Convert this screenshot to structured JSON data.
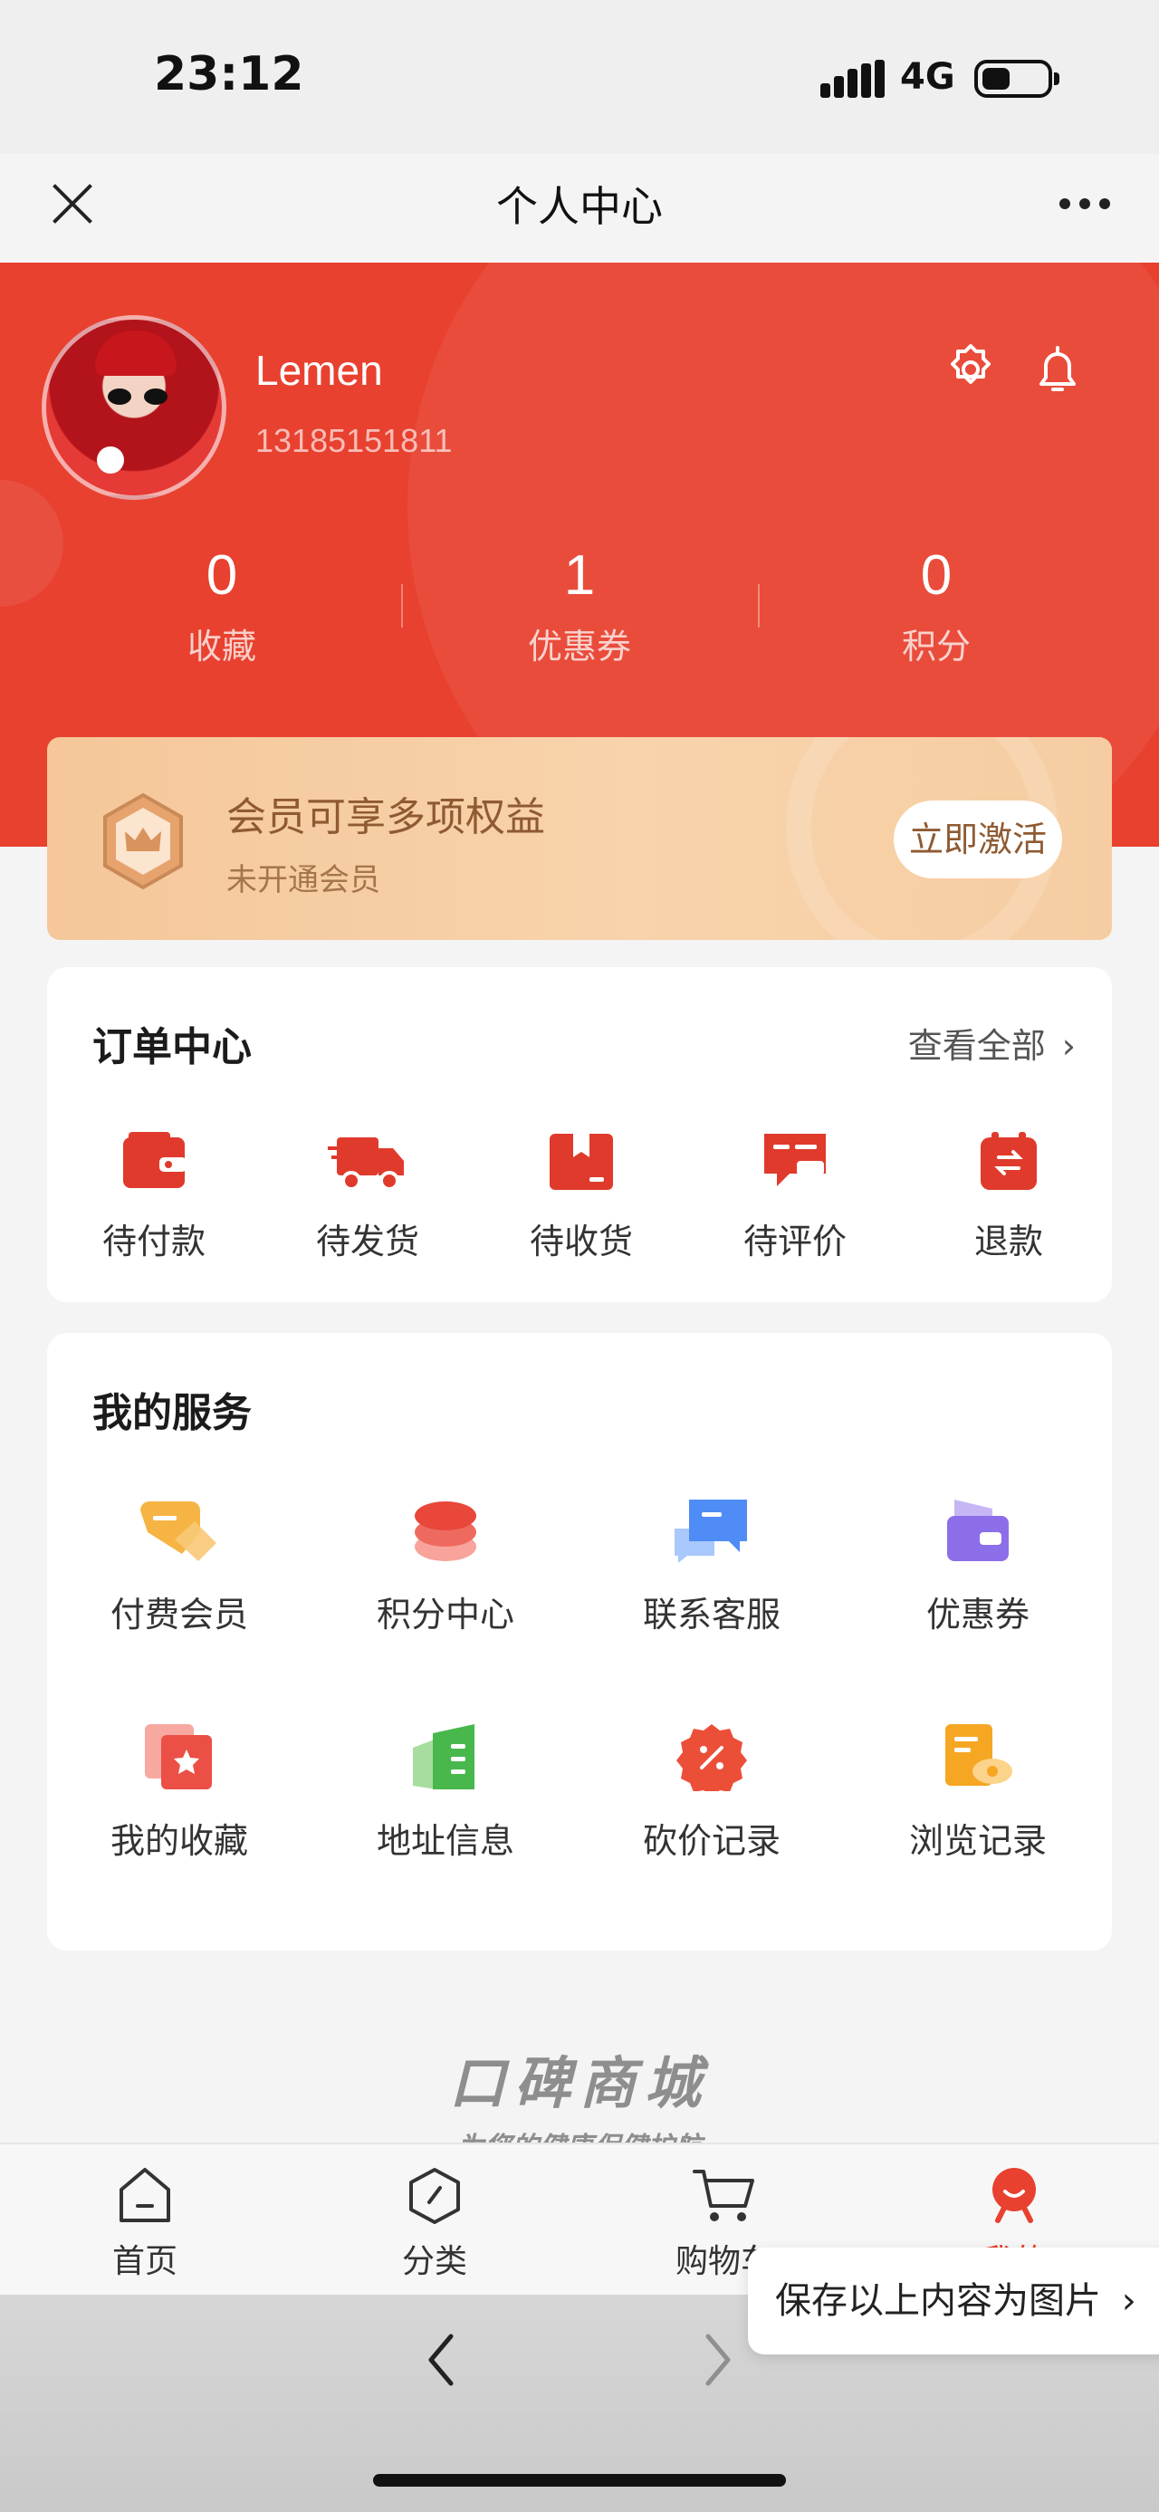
{
  "status_bar": {
    "time": "23:12",
    "network": "4G"
  },
  "nav": {
    "title": "个人中心"
  },
  "profile": {
    "name": "Lemen",
    "phone": "13185151811"
  },
  "stats": [
    {
      "value": "0",
      "label": "收藏"
    },
    {
      "value": "1",
      "label": "优惠券"
    },
    {
      "value": "0",
      "label": "积分"
    }
  ],
  "member": {
    "title": "会员可享多项权益",
    "subtitle": "未开通会员",
    "button": "立即激活"
  },
  "orders": {
    "title": "订单中心",
    "view_all": "查看全部",
    "items": [
      {
        "label": "待付款",
        "icon": "wallet-icon"
      },
      {
        "label": "待发货",
        "icon": "truck-icon"
      },
      {
        "label": "待收货",
        "icon": "package-icon"
      },
      {
        "label": "待评价",
        "icon": "review-icon"
      },
      {
        "label": "退款",
        "icon": "refund-icon"
      }
    ]
  },
  "services": {
    "title": "我的服务",
    "items": [
      {
        "label": "付费会员",
        "icon": "member-tag-icon"
      },
      {
        "label": "积分中心",
        "icon": "points-coins-icon"
      },
      {
        "label": "联系客服",
        "icon": "chat-icon"
      },
      {
        "label": "优惠券",
        "icon": "coupon-wallet-icon"
      },
      {
        "label": "我的收藏",
        "icon": "favorites-star-icon"
      },
      {
        "label": "地址信息",
        "icon": "address-book-icon"
      },
      {
        "label": "砍价记录",
        "icon": "discount-badge-icon"
      },
      {
        "label": "浏览记录",
        "icon": "history-eye-icon"
      }
    ]
  },
  "brand": {
    "logo": "口碑商城",
    "slogan": "为您的健康保健护航"
  },
  "tabbar": [
    {
      "label": "首页",
      "icon": "home-icon"
    },
    {
      "label": "分类",
      "icon": "category-icon"
    },
    {
      "label": "购物车",
      "icon": "cart-icon"
    },
    {
      "label": "我的",
      "icon": "profile-icon"
    }
  ],
  "active_tab": "我的",
  "save_image": "保存以上内容为图片",
  "colors": {
    "accent": "#e8412f",
    "member_gold": "#f6cda2",
    "member_text": "#8f5a32"
  }
}
